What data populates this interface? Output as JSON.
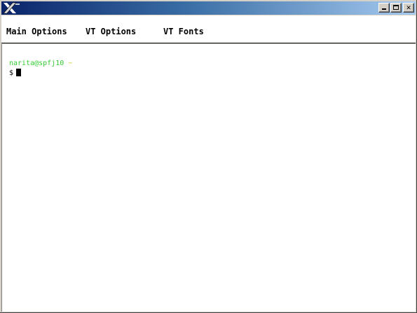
{
  "window": {
    "app_icon": "x-window-system-icon",
    "controls": {
      "minimize": "minimize-icon",
      "maximize": "maximize-icon",
      "close_label": "✕"
    },
    "colors": {
      "title_active": "#0a246a",
      "title_gradient_end": "#a6caf0",
      "chrome": "#d4d0c8"
    }
  },
  "menubar": {
    "items": [
      {
        "label": "Main Options"
      },
      {
        "label": "VT Options"
      },
      {
        "label": "VT Fonts"
      }
    ]
  },
  "terminal": {
    "user_host": "narita@spfj10",
    "cwd": "~",
    "prompt_symbol": "$",
    "colors": {
      "user_host": "#33cc33",
      "cwd": "#cccc33",
      "background": "#ffffff",
      "text": "#000000"
    }
  }
}
